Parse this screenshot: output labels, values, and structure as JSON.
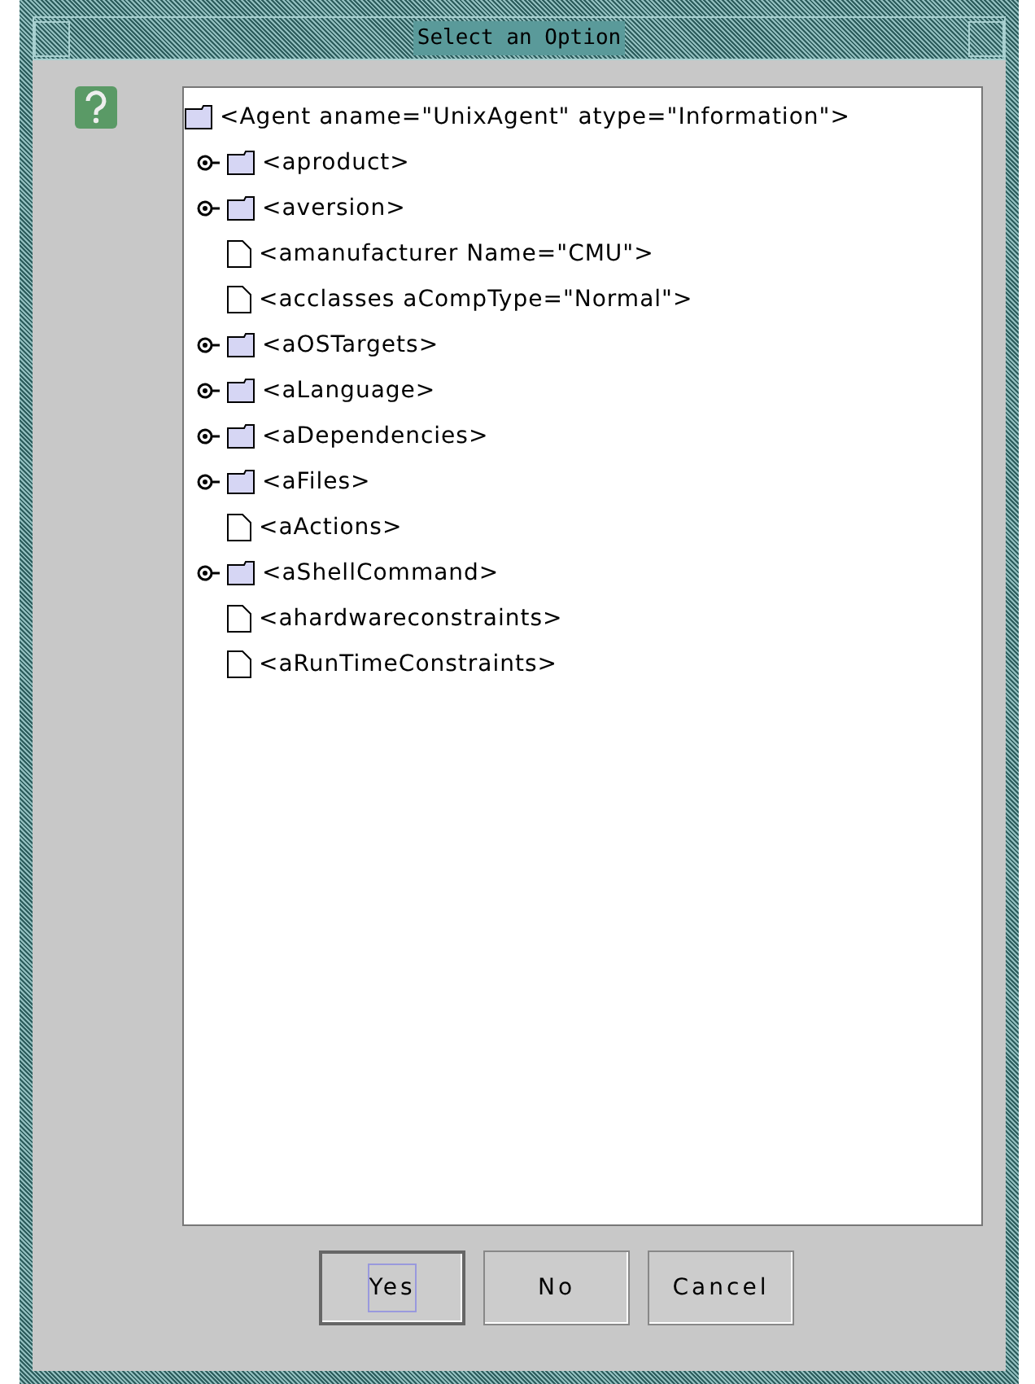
{
  "window": {
    "title": "Select an Option"
  },
  "tree": {
    "label": "<Agent aname=\"UnixAgent\" atype=\"Information\">",
    "kind": "folder",
    "children": [
      {
        "label": "<aproduct>",
        "kind": "folder"
      },
      {
        "label": "<aversion>",
        "kind": "folder"
      },
      {
        "label": "<amanufacturer Name=\"CMU\">",
        "kind": "leaf"
      },
      {
        "label": "<acclasses aCompType=\"Normal\">",
        "kind": "leaf"
      },
      {
        "label": "<aOSTargets>",
        "kind": "folder"
      },
      {
        "label": "<aLanguage>",
        "kind": "folder"
      },
      {
        "label": "<aDependencies>",
        "kind": "folder"
      },
      {
        "label": "<aFiles>",
        "kind": "folder"
      },
      {
        "label": "<aActions>",
        "kind": "leaf"
      },
      {
        "label": "<aShellCommand>",
        "kind": "folder"
      },
      {
        "label": "<ahardwareconstraints>",
        "kind": "leaf"
      },
      {
        "label": "<aRunTimeConstraints>",
        "kind": "leaf"
      }
    ]
  },
  "buttons": [
    {
      "label": "Yes",
      "focused": true
    },
    {
      "label": "No",
      "focused": false
    },
    {
      "label": "Cancel",
      "focused": false
    }
  ]
}
